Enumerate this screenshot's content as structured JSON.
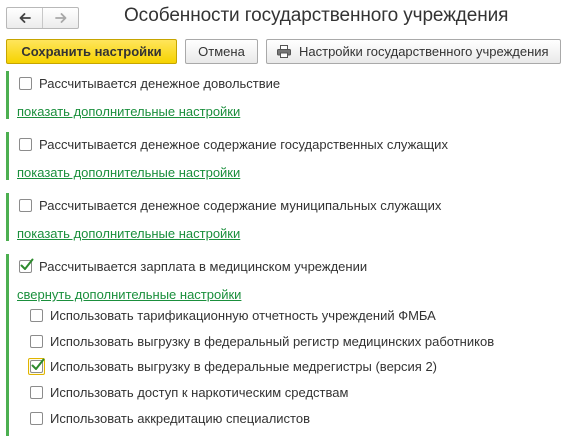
{
  "window": {
    "title": "Особенности государственного учреждения"
  },
  "nav": {
    "back_icon": "arrow-left-icon",
    "forward_icon": "arrow-right-icon"
  },
  "toolbar": {
    "save_label": "Сохранить настройки",
    "cancel_label": "Отмена",
    "settings_label": "Настройки государственного учреждения",
    "settings_icon": "printer-icon"
  },
  "colors": {
    "accent_yellow": "#f6d300",
    "section_bar": "#4caf50",
    "link": "#1a8f3c",
    "checkmark": "#2e8b2e"
  },
  "sections": [
    {
      "label": "Рассчитывается денежное довольствие",
      "checked": false,
      "link": "показать дополнительные настройки"
    },
    {
      "label": "Рассчитывается денежное содержание государственных служащих",
      "checked": false,
      "link": "показать дополнительные настройки"
    },
    {
      "label": "Рассчитывается денежное содержание муниципальных служащих",
      "checked": false,
      "link": "показать дополнительные настройки"
    },
    {
      "label": "Рассчитывается зарплата в медицинском учреждении",
      "checked": true,
      "link": "свернуть дополнительные настройки",
      "options": [
        {
          "label": "Использовать тарификационную отчетность учреждений ФМБА",
          "checked": false
        },
        {
          "label": "Использовать выгрузку в федеральный регистр медицинских работников",
          "checked": false
        },
        {
          "label": "Использовать выгрузку в федеральные медрегистры (версия 2)",
          "checked": true
        },
        {
          "label": "Использовать доступ к наркотическим средствам",
          "checked": false
        },
        {
          "label": "Использовать аккредитацию специалистов",
          "checked": false
        }
      ]
    }
  ]
}
